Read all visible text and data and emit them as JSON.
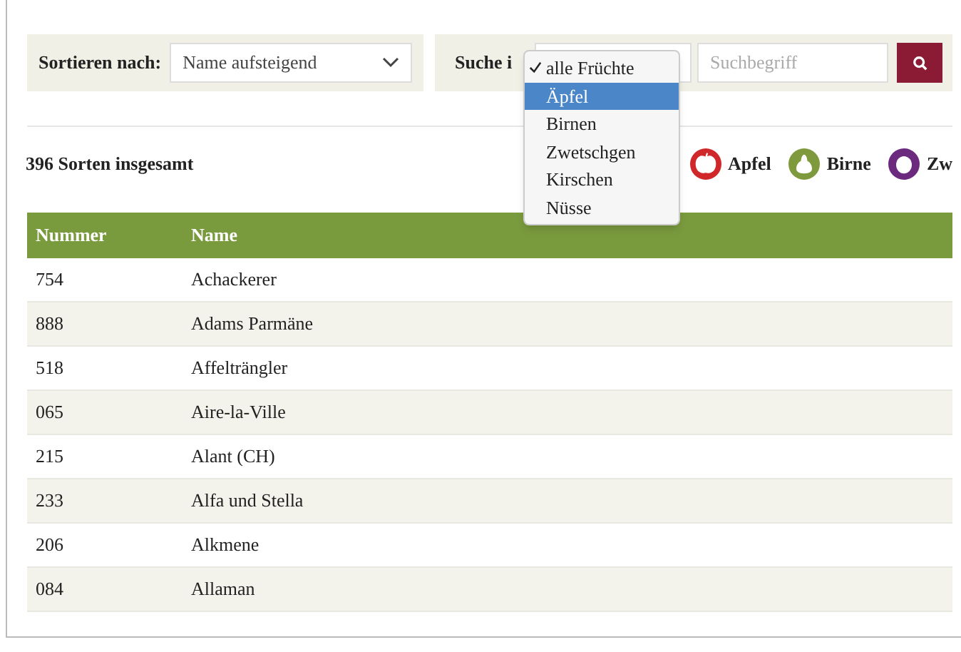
{
  "sort": {
    "label": "Sortieren nach:",
    "value": "Name aufsteigend"
  },
  "search": {
    "label": "Suche i",
    "placeholder": "Suchbegriff"
  },
  "fruit_menu": [
    {
      "label": "alle Früchte",
      "checked": true,
      "selected": false
    },
    {
      "label": "Äpfel",
      "checked": false,
      "selected": true
    },
    {
      "label": "Birnen",
      "checked": false,
      "selected": false
    },
    {
      "label": "Zwetschgen",
      "checked": false,
      "selected": false
    },
    {
      "label": "Kirschen",
      "checked": false,
      "selected": false
    },
    {
      "label": "Nüsse",
      "checked": false,
      "selected": false
    }
  ],
  "count": "396 Sorten insgesamt",
  "legend": [
    {
      "label": "Apfel",
      "color": "#d0282a",
      "kind": "apple"
    },
    {
      "label": "Birne",
      "color": "#7f9a3c",
      "kind": "pear"
    },
    {
      "label": "Zw",
      "color": "#6b2a7e",
      "kind": "plum"
    }
  ],
  "table": {
    "columns": [
      "Nummer",
      "Name"
    ],
    "rows": [
      [
        "754",
        "Achackerer"
      ],
      [
        "888",
        "Adams Parmäne"
      ],
      [
        "518",
        "Affelträngler"
      ],
      [
        "065",
        "Aire-la-Ville"
      ],
      [
        "215",
        "Alant (CH)"
      ],
      [
        "233",
        "Alfa und Stella"
      ],
      [
        "206",
        "Alkmene"
      ],
      [
        "084",
        "Allaman"
      ]
    ]
  }
}
